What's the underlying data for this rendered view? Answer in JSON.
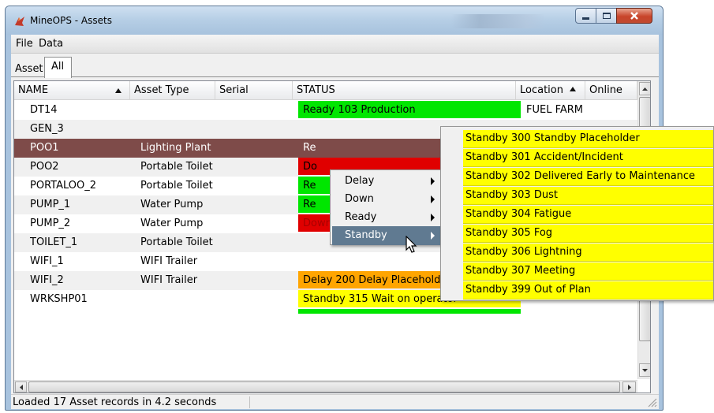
{
  "window": {
    "title": "MineOPS - Assets"
  },
  "menubar": {
    "items": [
      "File",
      "Data"
    ]
  },
  "tabs": {
    "asset_label": "Asset",
    "all_label": "All"
  },
  "table": {
    "columns": [
      "NAME",
      "Asset Type",
      "Serial",
      "STATUS",
      "Location",
      "Online"
    ],
    "sort": {
      "name_sorted": "ascending",
      "location_sorted": "ascending"
    },
    "rows": [
      {
        "name": "DT14",
        "type": "",
        "serial": "",
        "status": "Ready 103 Production",
        "status_color": "#00e600",
        "location": "FUEL FARM"
      },
      {
        "name": "GEN_3",
        "type": "",
        "serial": "",
        "status": "",
        "status_color": "",
        "location": ""
      },
      {
        "name": "POO1",
        "type": "Lighting Plant",
        "serial": "",
        "status": "Re",
        "status_color": "",
        "location": ""
      },
      {
        "name": "POO2",
        "type": "Portable Toilet",
        "serial": "",
        "status": "Do",
        "status_color": "#e00000",
        "location": ""
      },
      {
        "name": "PORTALOO_2",
        "type": "Portable Toilet",
        "serial": "",
        "status": "Re",
        "status_color": "#00e600",
        "location": ""
      },
      {
        "name": "PUMP_1",
        "type": "Water Pump",
        "serial": "",
        "status": "Re",
        "status_color": "#00e600",
        "location": ""
      },
      {
        "name": "PUMP_2",
        "type": "Water Pump",
        "serial": "",
        "status": "Down 401 Breakdown P",
        "status_color": "#e00000",
        "location": ""
      },
      {
        "name": "TOILET_1",
        "type": "Portable Toilet",
        "serial": "",
        "status": "",
        "status_color": "",
        "location": ""
      },
      {
        "name": "WIFI_1",
        "type": "WIFI Trailer",
        "serial": "",
        "status": "",
        "status_color": "",
        "location": ""
      },
      {
        "name": "WIFI_2",
        "type": "WIFI Trailer",
        "serial": "",
        "status": "Delay 200 Delay Placeholder",
        "status_color": "#ffa500",
        "location": ""
      },
      {
        "name": "WRKSHP01",
        "type": "",
        "serial": "",
        "status": "Standby 315 Wait on operator",
        "status_color": "#ffff00",
        "location": ""
      }
    ]
  },
  "context_menu": {
    "items": [
      "Delay",
      "Down",
      "Ready",
      "Standby"
    ],
    "hovered": "Standby"
  },
  "submenu": {
    "items": [
      "Standby 300 Standby Placeholder",
      "Standby 301 Accident/Incident",
      "Standby 302 Delivered Early to Maintenance",
      "Standby 303 Dust",
      "Standby 304 Fatigue",
      "Standby 305 Fog",
      "Standby 306 Lightning",
      "Standby 307 Meeting",
      "Standby 399 Out of Plan"
    ],
    "item_color": "#ffff00"
  },
  "statusbar": {
    "text": "Loaded 17 Asset records in 4.2 seconds"
  },
  "colors": {
    "selected_row": "#7e4b49",
    "menu_hover": "#607a91",
    "ready": "#00e600",
    "down": "#e00000",
    "delay": "#ffa500",
    "standby": "#ffff00"
  }
}
